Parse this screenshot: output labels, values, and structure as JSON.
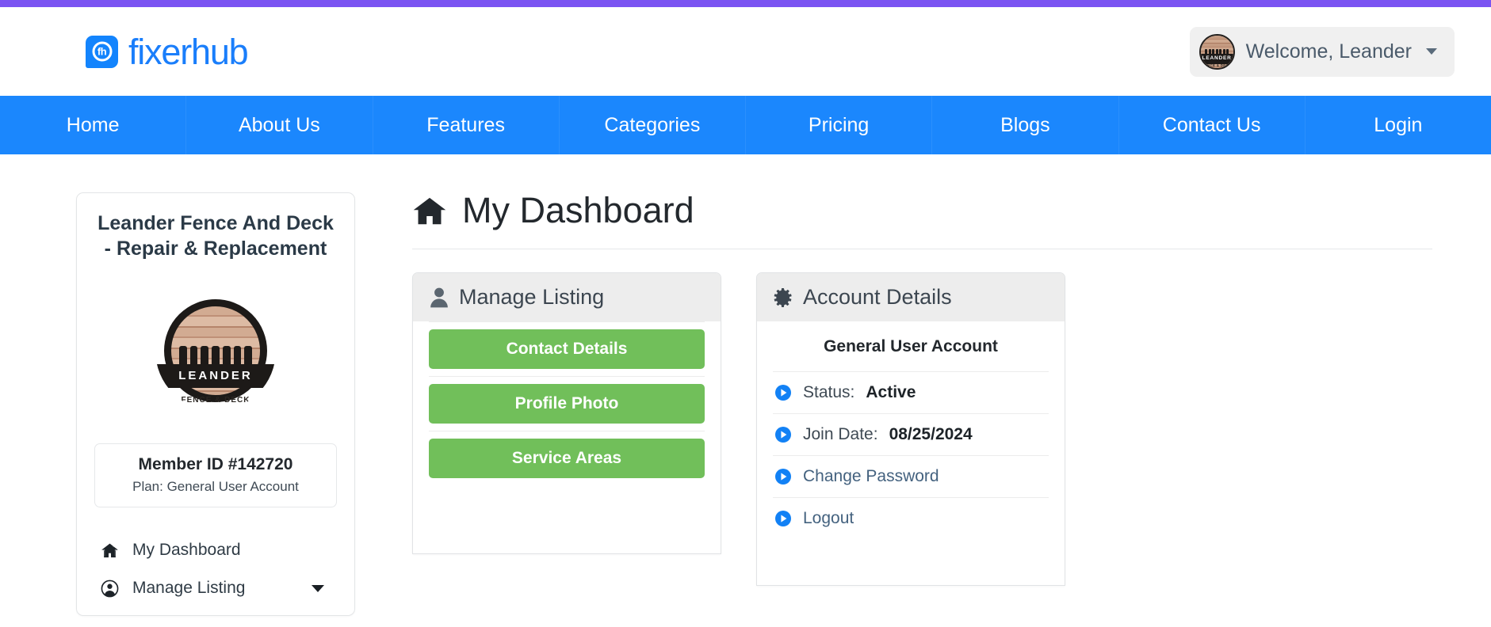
{
  "accent_color": "#7b54f2",
  "nav_color": "#1b87fd",
  "brand": {
    "mark_text": "fh",
    "name": "fixerhub",
    "name_color": "#1a7efb"
  },
  "header": {
    "welcome_label": "Welcome, Leander",
    "avatar_name": "LEANDER",
    "avatar_sub": "FENCE & DECK",
    "chevron_icon": "chevron-down-icon"
  },
  "nav": {
    "items": [
      {
        "label": "Home"
      },
      {
        "label": "About Us"
      },
      {
        "label": "Features"
      },
      {
        "label": "Categories"
      },
      {
        "label": "Pricing"
      },
      {
        "label": "Blogs"
      },
      {
        "label": "Contact Us"
      },
      {
        "label": "Login"
      }
    ]
  },
  "sidebar": {
    "business_name": "Leander Fence And Deck - Repair & Replacement",
    "logo": {
      "name": "LEANDER",
      "sub": "FENCE & DECK"
    },
    "member_id": "Member ID #142720",
    "plan": "Plan: General User Account",
    "links": [
      {
        "label": "My Dashboard",
        "icon": "home-icon",
        "has_caret": false
      },
      {
        "label": "Manage Listing",
        "icon": "user-circle-icon",
        "has_caret": true
      }
    ]
  },
  "main": {
    "page_title": "My Dashboard",
    "page_title_icon": "home-icon",
    "manage_listing": {
      "heading": "Manage Listing",
      "heading_icon": "user-icon",
      "buttons": [
        {
          "label": "Contact Details"
        },
        {
          "label": "Profile Photo"
        },
        {
          "label": "Service Areas"
        }
      ],
      "button_color": "#71bf5a"
    },
    "account_details": {
      "heading": "Account Details",
      "heading_icon": "gear-icon",
      "account_type": "General User Account",
      "rows": [
        {
          "label": "Status:",
          "value": "Active",
          "is_link": false,
          "icon": "play-circle-icon"
        },
        {
          "label": "Join Date:",
          "value": "08/25/2024",
          "is_link": false,
          "icon": "play-circle-icon"
        },
        {
          "label": "Change Password",
          "value": "",
          "is_link": true,
          "icon": "play-circle-icon"
        },
        {
          "label": "Logout",
          "value": "",
          "is_link": true,
          "icon": "play-circle-icon"
        }
      ]
    }
  }
}
